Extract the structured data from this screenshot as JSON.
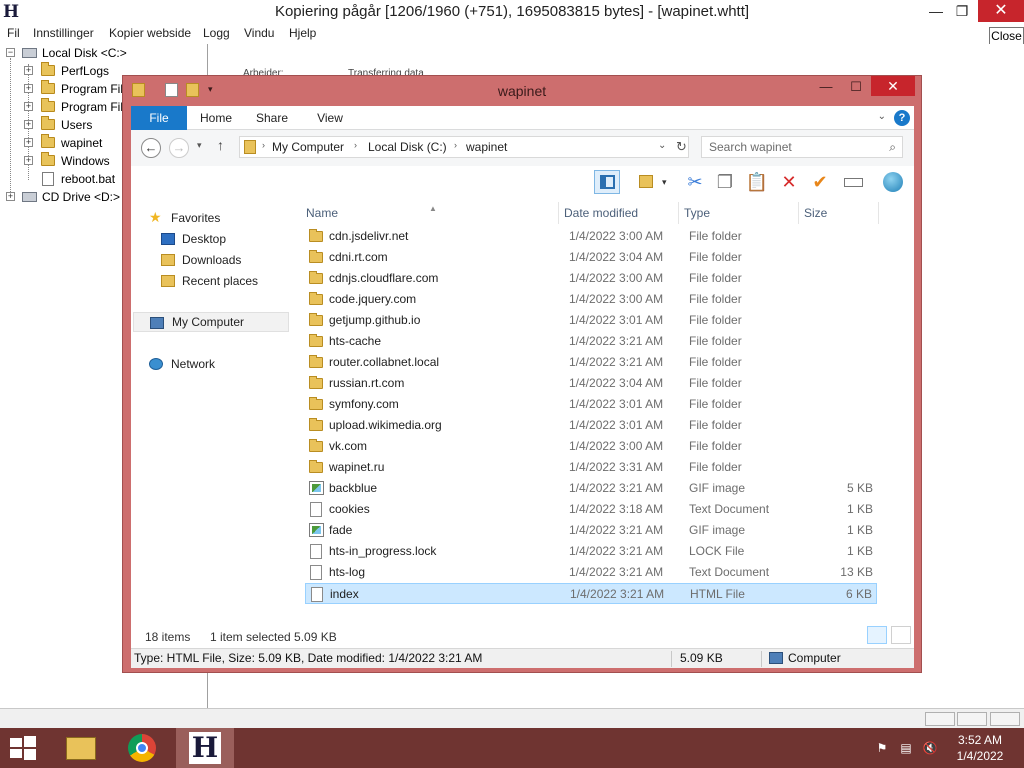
{
  "app": {
    "title": "Kopiering pågår [1206/1960 (+751), 1695083815 bytes] - [wapinet.whtt]",
    "logo": "H",
    "minimize": "—",
    "maximize": "❐",
    "close": "✕",
    "tooltip": "Close"
  },
  "menu": [
    "Fil",
    "Innstillinger",
    "Kopier webside",
    "Logg",
    "Vindu",
    "Hjelp"
  ],
  "tree": {
    "root": "Local Disk <C:>",
    "children": [
      "PerfLogs",
      "Program Fil",
      "Program Fil",
      "Users",
      "wapinet",
      "Windows"
    ],
    "file": "reboot.bat",
    "cd": "CD Drive <D:>"
  },
  "right_panel": {
    "label1": "Arbeider:",
    "label2": "Transferring data"
  },
  "explorer": {
    "title": "wapinet",
    "minimize": "—",
    "maximize": "☐",
    "close": "✕",
    "ribbon_tabs": [
      "File",
      "Home",
      "Share",
      "View"
    ],
    "breadcrumb": [
      "My Computer",
      "Local Disk (C:)",
      "wapinet"
    ],
    "search_placeholder": "Search wapinet",
    "nav": {
      "favorites": "Favorites",
      "desktop": "Desktop",
      "downloads": "Downloads",
      "recent": "Recent places",
      "computer": "My Computer",
      "network": "Network"
    },
    "columns": [
      "Name",
      "Date modified",
      "Type",
      "Size"
    ],
    "files": [
      {
        "name": "cdn.jsdelivr.net",
        "date": "1/4/2022 3:00 AM",
        "type": "File folder",
        "size": "",
        "icon": "folder"
      },
      {
        "name": "cdni.rt.com",
        "date": "1/4/2022 3:04 AM",
        "type": "File folder",
        "size": "",
        "icon": "folder"
      },
      {
        "name": "cdnjs.cloudflare.com",
        "date": "1/4/2022 3:00 AM",
        "type": "File folder",
        "size": "",
        "icon": "folder"
      },
      {
        "name": "code.jquery.com",
        "date": "1/4/2022 3:00 AM",
        "type": "File folder",
        "size": "",
        "icon": "folder"
      },
      {
        "name": "getjump.github.io",
        "date": "1/4/2022 3:01 AM",
        "type": "File folder",
        "size": "",
        "icon": "folder"
      },
      {
        "name": "hts-cache",
        "date": "1/4/2022 3:21 AM",
        "type": "File folder",
        "size": "",
        "icon": "folder"
      },
      {
        "name": "router.collabnet.local",
        "date": "1/4/2022 3:21 AM",
        "type": "File folder",
        "size": "",
        "icon": "folder"
      },
      {
        "name": "russian.rt.com",
        "date": "1/4/2022 3:04 AM",
        "type": "File folder",
        "size": "",
        "icon": "folder"
      },
      {
        "name": "symfony.com",
        "date": "1/4/2022 3:01 AM",
        "type": "File folder",
        "size": "",
        "icon": "folder"
      },
      {
        "name": "upload.wikimedia.org",
        "date": "1/4/2022 3:01 AM",
        "type": "File folder",
        "size": "",
        "icon": "folder"
      },
      {
        "name": "vk.com",
        "date": "1/4/2022 3:00 AM",
        "type": "File folder",
        "size": "",
        "icon": "folder"
      },
      {
        "name": "wapinet.ru",
        "date": "1/4/2022 3:31 AM",
        "type": "File folder",
        "size": "",
        "icon": "folder"
      },
      {
        "name": "backblue",
        "date": "1/4/2022 3:21 AM",
        "type": "GIF image",
        "size": "5 KB",
        "icon": "image"
      },
      {
        "name": "cookies",
        "date": "1/4/2022 3:18 AM",
        "type": "Text Document",
        "size": "1 KB",
        "icon": "doc"
      },
      {
        "name": "fade",
        "date": "1/4/2022 3:21 AM",
        "type": "GIF image",
        "size": "1 KB",
        "icon": "image"
      },
      {
        "name": "hts-in_progress.lock",
        "date": "1/4/2022 3:21 AM",
        "type": "LOCK File",
        "size": "1 KB",
        "icon": "doc"
      },
      {
        "name": "hts-log",
        "date": "1/4/2022 3:21 AM",
        "type": "Text Document",
        "size": "13 KB",
        "icon": "doc"
      },
      {
        "name": "index",
        "date": "1/4/2022 3:21 AM",
        "type": "HTML File",
        "size": "6 KB",
        "icon": "doc",
        "selected": true
      }
    ],
    "item_count": "18 items",
    "selection": "1 item selected  5.09 KB",
    "statusbar": {
      "details": "Type: HTML File, Size: 5.09 KB, Date modified: 1/4/2022 3:21 AM",
      "size": "5.09 KB",
      "location": "Computer"
    }
  },
  "taskbar": {
    "time": "3:52 AM",
    "date": "1/4/2022"
  },
  "colors": {
    "explorer_frame": "#cd6e6e",
    "taskbar": "#6f3431",
    "selection": "#cce8ff",
    "ribbon_file": "#1979ca"
  }
}
